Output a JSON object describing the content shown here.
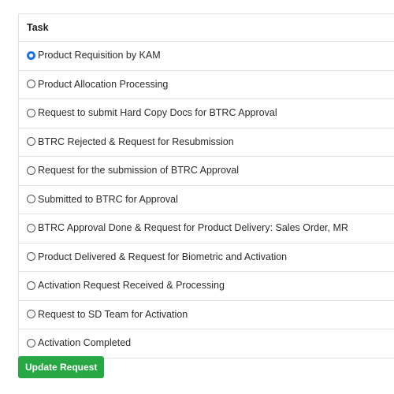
{
  "task_table": {
    "header": "Task",
    "selected_index": 0,
    "options": [
      {
        "label": "Product Requisition by KAM",
        "checked": true
      },
      {
        "label": "Product Allocation Processing",
        "checked": false
      },
      {
        "label": "Request to submit Hard Copy Docs for BTRC Approval",
        "checked": false
      },
      {
        "label": "BTRC Rejected & Request for Resubmission",
        "checked": false
      },
      {
        "label": "Request for the submission of BTRC Approval",
        "checked": false
      },
      {
        "label": "Submitted to BTRC for Approval",
        "checked": false
      },
      {
        "label": "BTRC Approval Done & Request for Product Delivery: Sales Order, MR",
        "checked": false
      },
      {
        "label": "Product Delivered & Request for Biometric and Activation",
        "checked": false
      },
      {
        "label": "Activation Request Received & Processing",
        "checked": false
      },
      {
        "label": "Request to SD Team for Activation",
        "checked": false
      },
      {
        "label": "Activation Completed",
        "checked": false
      }
    ]
  },
  "actions": {
    "update_label": "Update Request"
  },
  "colors": {
    "primary_radio": "#1a73e8",
    "button_green": "#28a745",
    "border": "#e2e2e2"
  }
}
